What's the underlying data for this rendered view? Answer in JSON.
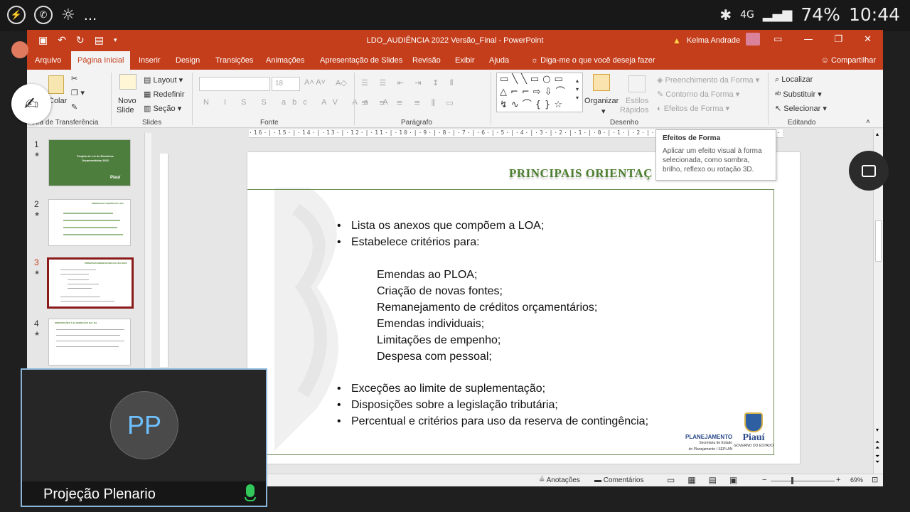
{
  "phone_status": {
    "left_icons": [
      "messenger-icon",
      "whatsapp-icon",
      "weather-icon"
    ],
    "more": "...",
    "signal": "4G",
    "battery": "74%",
    "time": "10:44"
  },
  "window": {
    "title": "LDO_AUDIÊNCIA 2022 Versão_Final - PowerPoint",
    "user": "Kelma Andrade",
    "qat_icons": [
      "save-icon",
      "undo-icon",
      "redo-icon",
      "present-icon",
      "customize-icon"
    ]
  },
  "tabs": [
    "Arquivo",
    "Página Inicial",
    "Inserir",
    "Design",
    "Transições",
    "Animações",
    "Apresentação de Slides",
    "Revisão",
    "Exibir",
    "Ajuda"
  ],
  "tell_me": "Diga-me o que você deseja fazer",
  "share": "Compartilhar",
  "ribbon": {
    "clipboard": {
      "paste": "Colar",
      "label": "Área de Transferência"
    },
    "slides": {
      "new_slide_1": "Novo",
      "new_slide_2": "Slide",
      "layout": "Layout",
      "reset": "Redefinir",
      "section": "Seção",
      "label": "Slides"
    },
    "font": {
      "label": "Fonte",
      "size": "18",
      "format_buttons": [
        "N",
        "I",
        "S",
        "S",
        "abc",
        "AV",
        "Aa",
        "A"
      ]
    },
    "paragraph": {
      "label": "Parágrafo"
    },
    "drawing": {
      "arrange": "Organizar",
      "quick_styles_1": "Estilos",
      "quick_styles_2": "Rápidos",
      "fill": "Preenchimento da Forma",
      "outline": "Contorno da Forma",
      "effects": "Efeitos de Forma",
      "label": "Desenho"
    },
    "editing": {
      "find": "Localizar",
      "replace": "Substituir",
      "select": "Selecionar",
      "label": "Editando"
    }
  },
  "tooltip": {
    "title": "Efeitos de Forma",
    "body": "Aplicar um efeito visual à forma selecionada, como sombra, brilho, reflexo ou rotação 3D."
  },
  "ruler_text": "·16·|·15·|·14·|·13·|·12·|·11·|·10·|·9·|·8·|·7·|·6·|·5·|·4·|·3·|·2·|·1·|·0·|·1·|·2·|·3·|·4·|·5·|·6·|·7·|·8·|·9·|·10·|·11·|·12·|·13·|·14·|·15·|·16·",
  "thumbnails": [
    {
      "num": "1",
      "star": "★",
      "title": "Projeto de Lei de Diretrizes Orçamentárias 2022",
      "footer": "Piauí"
    },
    {
      "num": "2",
      "star": "★",
      "title": "PRINCIPAIS FUNÇÕES DA LDO"
    },
    {
      "num": "3",
      "star": "★",
      "title": "PRINCIPAIS ORIENTAÇÕES DA LDO 2022"
    },
    {
      "num": "4",
      "star": "★",
      "title": "ORIENTAÇÕES À ELABORAÇÃO DA LOA"
    }
  ],
  "slide": {
    "title": "PRINCIPAIS ORIENTAÇ",
    "bullets_top": [
      "Lista os anexos que compõem a LOA;",
      "Estabelece critérios para:"
    ],
    "sub_items": [
      "Emendas ao PLOA;",
      "Criação de novas fontes;",
      "Remanejamento de créditos orçamentários;",
      "Emendas individuais;",
      "Limitações de empenho;",
      "Despesa com pessoal;"
    ],
    "bullets_bottom": [
      "Exceções ao limite de suplementação;",
      "Disposições sobre a legislação tributária;",
      "Percentual e critérios para uso da reserva de contingência;"
    ],
    "logo_left_1": "PLANEJAMENTO",
    "logo_left_2": "Secretaria de Estado",
    "logo_left_3": "do Planejamento / SEPLAN",
    "logo_right": "Piauí",
    "logo_right_sub": "GOVERNO DO ESTADO"
  },
  "statusbar": {
    "notes": "Anotações",
    "comments": "Comentários",
    "zoom": "69%",
    "minus": "−",
    "plus": "+"
  },
  "video": {
    "initials": "PP",
    "name": "Projeção Plenario"
  }
}
